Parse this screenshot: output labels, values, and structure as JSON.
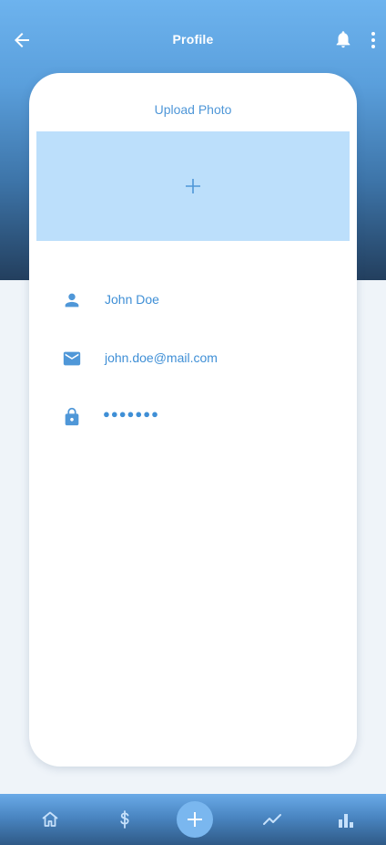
{
  "header": {
    "title": "Profile",
    "back_icon": "arrow-back-icon",
    "bell_icon": "bell-icon",
    "more_icon": "more-vertical-icon"
  },
  "upload": {
    "label": "Upload Photo",
    "icon": "plus-icon"
  },
  "fields": {
    "name": {
      "icon": "person-icon",
      "value": "John Doe"
    },
    "email": {
      "icon": "mail-icon",
      "value": "john.doe@mail.com"
    },
    "password": {
      "icon": "lock-icon",
      "value": "●●●●●●●"
    }
  },
  "bottom_nav": {
    "items": [
      "home-icon",
      "dollar-icon",
      "add-icon",
      "trend-icon",
      "bar-chart-icon"
    ]
  },
  "colors": {
    "accent": "#4f97d8",
    "upload_bg": "#bcdffb",
    "hero_top": "#6db3ee",
    "hero_bottom": "#233f5e"
  }
}
